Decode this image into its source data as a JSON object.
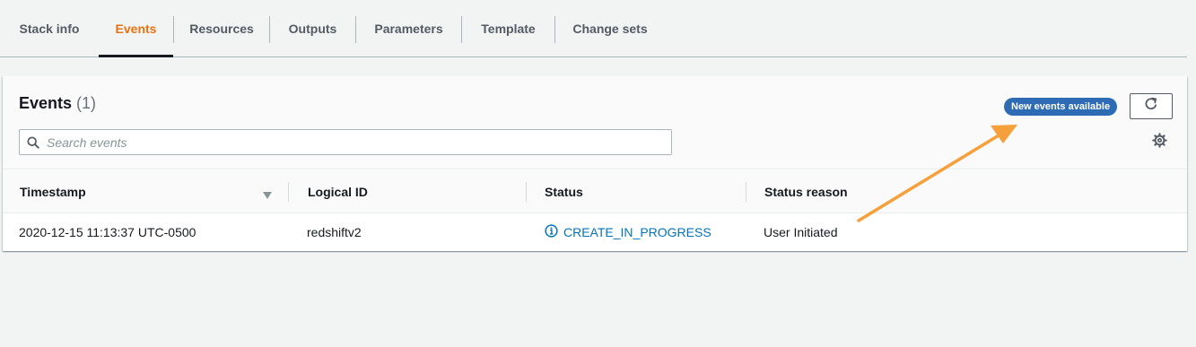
{
  "tabs": [
    {
      "label": "Stack info",
      "active": false
    },
    {
      "label": "Events",
      "active": true
    },
    {
      "label": "Resources",
      "active": false
    },
    {
      "label": "Outputs",
      "active": false
    },
    {
      "label": "Parameters",
      "active": false
    },
    {
      "label": "Template",
      "active": false
    },
    {
      "label": "Change sets",
      "active": false
    }
  ],
  "panel": {
    "title": "Events",
    "count": "(1)",
    "badge": "New events available",
    "search_placeholder": "Search events"
  },
  "table": {
    "columns": [
      "Timestamp",
      "Logical ID",
      "Status",
      "Status reason"
    ],
    "rows": [
      {
        "timestamp": "2020-12-15 11:13:37 UTC-0500",
        "logical_id": "redshiftv2",
        "status": "CREATE_IN_PROGRESS",
        "status_reason": "User Initiated"
      }
    ]
  },
  "icons": {
    "search": "search-icon",
    "refresh": "refresh-icon",
    "settings": "gear-icon",
    "sort": "sort-descending-icon",
    "status": "info-icon"
  },
  "colors": {
    "active_tab": "#ec7211",
    "badge_bg": "#2e6bb5",
    "link": "#0073bb",
    "annotation_arrow": "#f5a03a"
  }
}
